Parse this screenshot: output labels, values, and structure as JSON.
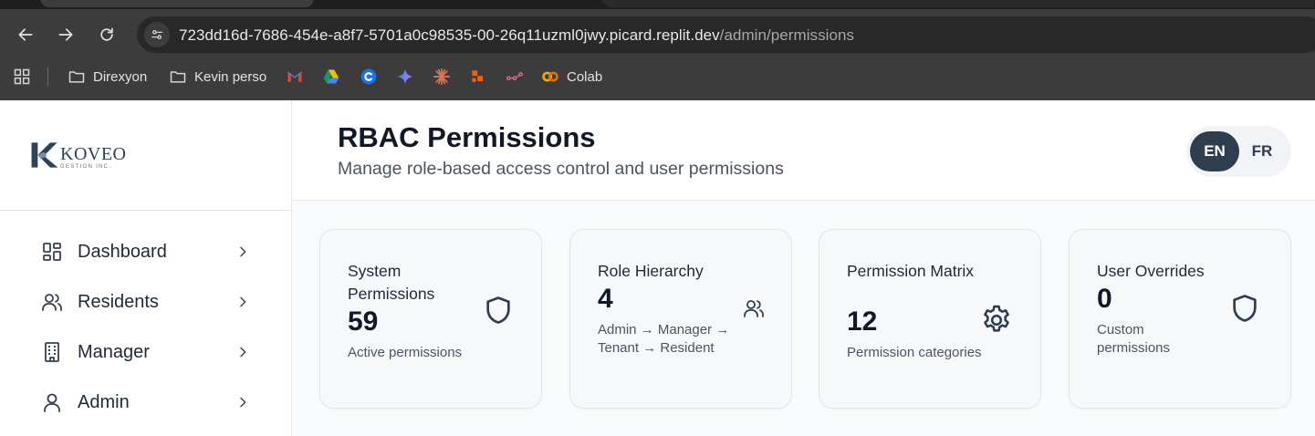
{
  "browser": {
    "url_host": "723dd16d-7686-454e-a8f7-5701a0c98535-00-26q11uzml0jwy.picard.replit.dev",
    "url_path": "/admin/permissions",
    "bookmarks": [
      {
        "label": "Direxyon",
        "icon": "folder-icon"
      },
      {
        "label": "Kevin perso",
        "icon": "folder-icon"
      },
      {
        "label": "",
        "icon": "gmail-icon"
      },
      {
        "label": "",
        "icon": "drive-icon"
      },
      {
        "label": "",
        "icon": "c-icon"
      },
      {
        "label": "",
        "icon": "sparkle-icon"
      },
      {
        "label": "",
        "icon": "burst-icon"
      },
      {
        "label": "",
        "icon": "blocks-icon"
      },
      {
        "label": "",
        "icon": "graph-icon"
      },
      {
        "label": "Colab",
        "icon": "colab-icon"
      }
    ]
  },
  "brand": {
    "name": "KOVEO",
    "tagline": "GESTION INC.",
    "primary_color": "#2e3e4f"
  },
  "sidebar": {
    "items": [
      {
        "label": "Dashboard",
        "icon": "dashboard-icon"
      },
      {
        "label": "Residents",
        "icon": "users-icon"
      },
      {
        "label": "Manager",
        "icon": "building-icon"
      },
      {
        "label": "Admin",
        "icon": "user-icon"
      }
    ]
  },
  "header": {
    "title": "RBAC Permissions",
    "subtitle": "Manage role-based access control and user permissions",
    "languages": [
      "EN",
      "FR"
    ],
    "active_language": "EN"
  },
  "cards": [
    {
      "title": "System Permissions",
      "value": "59",
      "description": "Active permissions",
      "icon": "shield-icon"
    },
    {
      "title": "Role Hierarchy",
      "value": "4",
      "description": "Admin → Manager → Tenant → Resident",
      "icon": "users-icon"
    },
    {
      "title": "Permission Matrix",
      "value": "12",
      "description": "Permission categories",
      "icon": "gear-icon"
    },
    {
      "title": "User Overrides",
      "value": "0",
      "description": "Custom permissions",
      "icon": "shield-icon"
    }
  ]
}
